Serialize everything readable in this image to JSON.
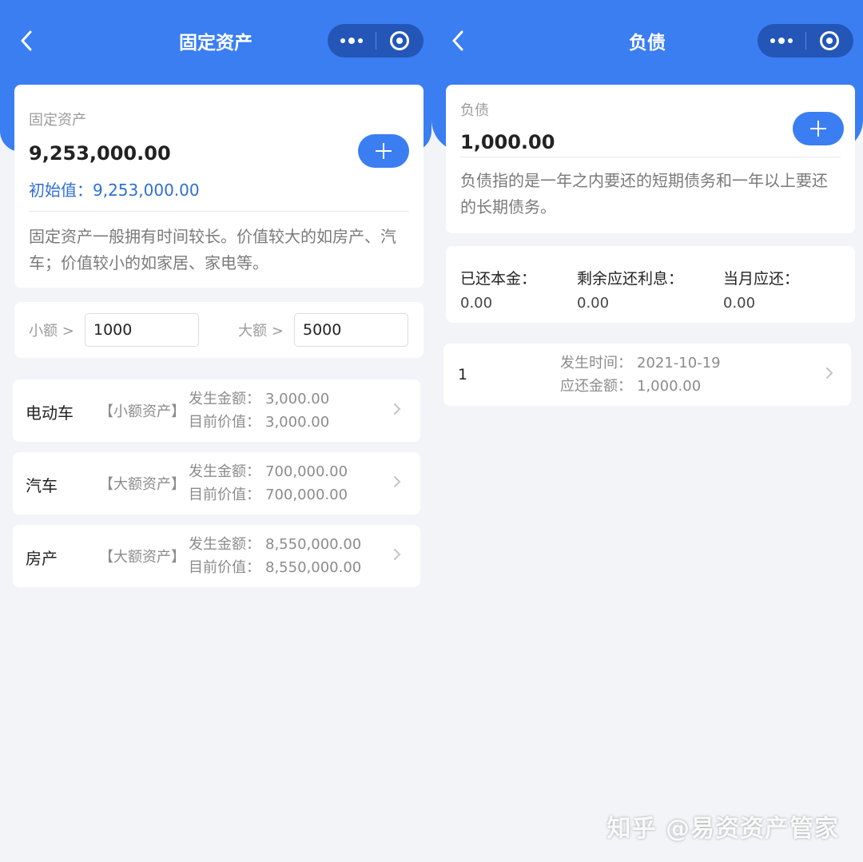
{
  "left": {
    "nav_title": "固定资产",
    "summary": {
      "label": "固定资产",
      "value": "9,253,000.00",
      "initial_prefix": "初始值：",
      "initial_value": "9,253,000.00",
      "description": "固定资产一般拥有时间较长。价值较大的如房产、汽车；价值较小的如家居、家电等。"
    },
    "thresholds": {
      "small_label": "小额 >",
      "small_value": "1000",
      "large_label": "大额 >",
      "large_value": "5000"
    },
    "assets": [
      {
        "name": "电动车",
        "tag": "【小额资产】",
        "amount_label": "发生金额：",
        "amount": "3,000.00",
        "current_label": "目前价值：",
        "current": "3,000.00"
      },
      {
        "name": "汽车",
        "tag": "【大额资产】",
        "amount_label": "发生金额：",
        "amount": "700,000.00",
        "current_label": "目前价值：",
        "current": "700,000.00"
      },
      {
        "name": "房产",
        "tag": "【大额资产】",
        "amount_label": "发生金额：",
        "amount": "8,550,000.00",
        "current_label": "目前价值：",
        "current": "8,550,000.00"
      }
    ]
  },
  "right": {
    "nav_title": "负债",
    "summary": {
      "label": "负债",
      "value": "1,000.00",
      "description": "负债指的是一年之内要还的短期债务和一年以上要还的长期债务。"
    },
    "stats": [
      {
        "label": "已还本金：",
        "value": "0.00"
      },
      {
        "label": "剩余应还利息：",
        "value": "0.00"
      },
      {
        "label": "当月应还：",
        "value": "0.00"
      }
    ],
    "records": [
      {
        "index": "1",
        "date_label": "发生时间：",
        "date": "2021-10-19",
        "amount_label": "应还金额：",
        "amount": "1,000.00"
      }
    ]
  },
  "watermark": "知乎 @易资资产管家",
  "colors": {
    "primary": "#3a7ef2",
    "capsule": "#2456b8",
    "background": "#f2f4f8",
    "link": "#2f6fd6"
  },
  "icons": {
    "back": "chevron-left-icon",
    "more": "more-dots-icon",
    "close": "target-circle-icon",
    "add": "plus-icon",
    "row": "chevron-right-icon"
  }
}
